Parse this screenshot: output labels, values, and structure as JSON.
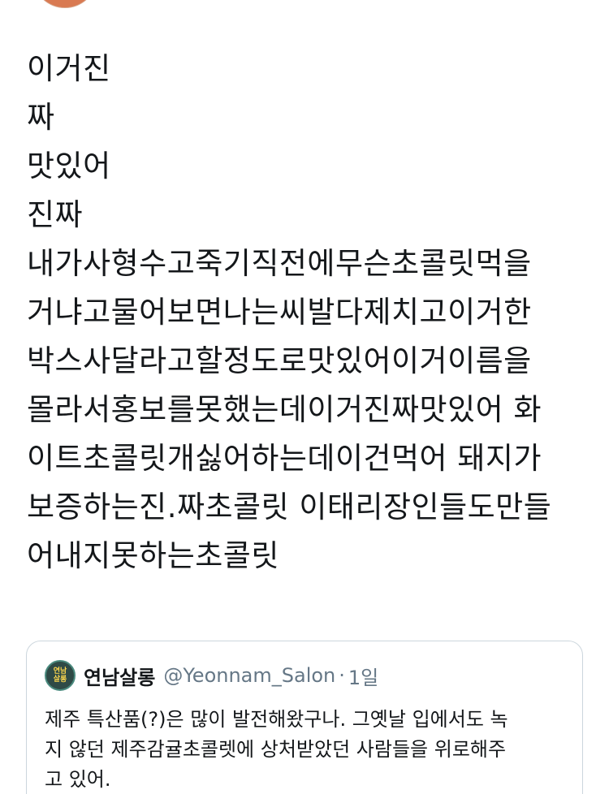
{
  "tweet": {
    "lines": [
      "이거진",
      "짜",
      "맛있어",
      "진짜",
      "내가사형수고죽기직전에무슨초콜릿먹을",
      "거냐고물어보면나는씨발다제치고이거한",
      "박스사달라고할정도로맛있어이거이름을",
      "몰라서홍보를못했는데이거진짜맛있어 화",
      "이트초콜릿개싫어하는데이건먹어 돼지가",
      "보증하는진.짜초콜릿 이태리장인들도만들",
      "어내지못하는초콜릿"
    ]
  },
  "quote": {
    "avatar_text_top": "연남",
    "avatar_text_bottom": "살롱",
    "name": "연남살롱",
    "handle": "@Yeonnam_Salon",
    "separator": "·",
    "time": "1일",
    "lines": [
      "제주 특산품(?)은 많이 발전해왔구나. 그옛날 입에서도 녹",
      "지 않던 제주감귤초콜렛에 상처받았던 사람들을 위로해주",
      "고 있어."
    ]
  }
}
